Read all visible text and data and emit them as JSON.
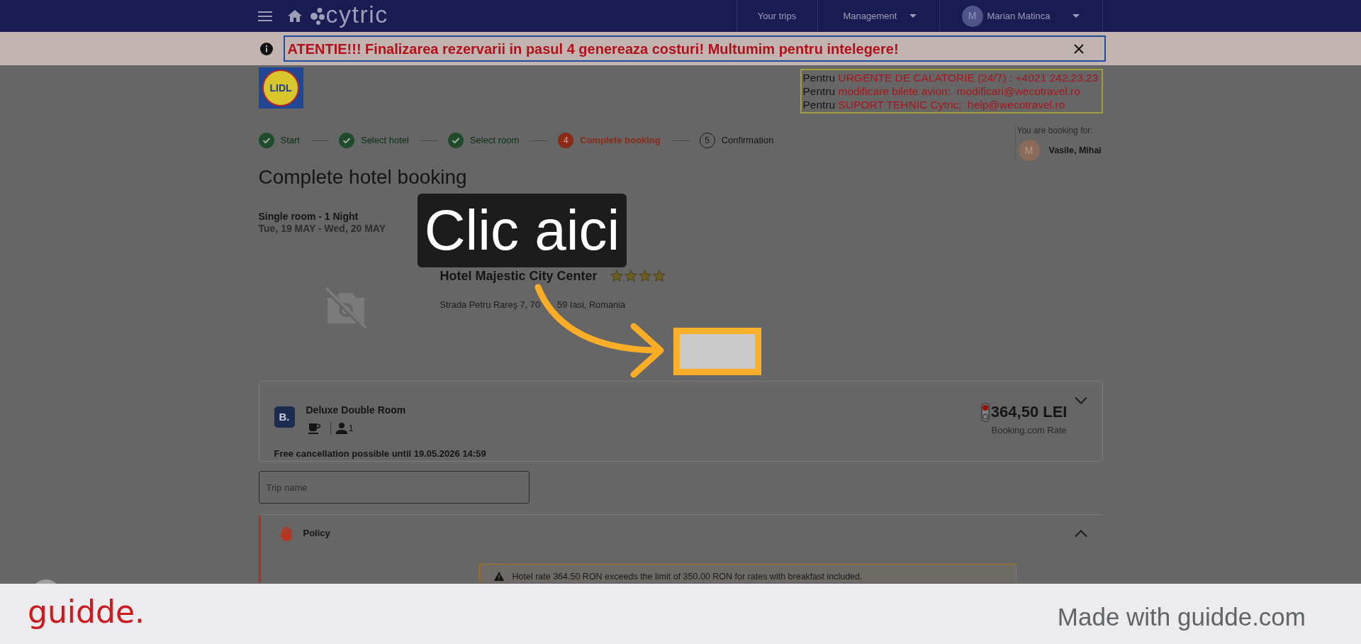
{
  "nav": {
    "logo_text": "cytric",
    "links": [
      {
        "label": "Your trips",
        "kind": "link"
      },
      {
        "label": "Management",
        "kind": "menu"
      }
    ],
    "user": {
      "initial": "M",
      "name": "Marian Matinca"
    }
  },
  "notice": {
    "text": "ATENTIE!!! Finalizarea rezervarii in pasul 4 genereaza costuri! Multumim pentru intelegere!"
  },
  "company_logo": {
    "text": "LIDL"
  },
  "contacts": [
    {
      "prefix": "Pentru",
      "detail": "URGENTE DE CALATORIE (24/7) : +4021 242.23.23"
    },
    {
      "prefix": "Pentru",
      "detail": "modificare bilete avion:  modificari@wecotravel.ro"
    },
    {
      "prefix": "Pentru",
      "detail": "SUPORT TEHNIC Cytric:  help@wecotravel.ro"
    }
  ],
  "steps": [
    {
      "label": "Start",
      "kind": "done"
    },
    {
      "label": "Select hotel",
      "kind": "done"
    },
    {
      "label": "Select room",
      "kind": "done"
    },
    {
      "label": "Complete booking",
      "kind": "current",
      "number": "4"
    },
    {
      "label": "Confirmation",
      "kind": "upcoming",
      "number": "5"
    }
  ],
  "booking_for": {
    "label": "You are booking for:",
    "initial": "M",
    "name": "Vasile, Mihai"
  },
  "title": "Complete hotel booking",
  "stay": {
    "room": "Single room - 1 Night",
    "dates": "Tue, 19 MAY - Wed, 20 MAY"
  },
  "hotel": {
    "name": "Hotel Majestic City Center",
    "stars": 4,
    "address_parts": [
      "Strada Petru Rareş 7, 70",
      "59 Iasi, Romania"
    ]
  },
  "offer": {
    "provider_logo": "B.",
    "room": "Deluxe Double Room",
    "guests": "1",
    "price": "364,50 LEI",
    "rate": "Booking.com Rate",
    "cancellation": "Free cancellation possible until 19.05.2026 14:59",
    "expanded": false
  },
  "trip_name": {
    "placeholder": "Trip name"
  },
  "policy": {
    "title": "Policy",
    "expanded": true,
    "warning": "Hotel rate 364.50 RON exceeds the limit of 350.00 RON for rates with breakfast included."
  },
  "guide": {
    "callout": "Clic aici"
  },
  "footer": {
    "logo": "guidde.",
    "tagline": "Made with guidde.com"
  }
}
